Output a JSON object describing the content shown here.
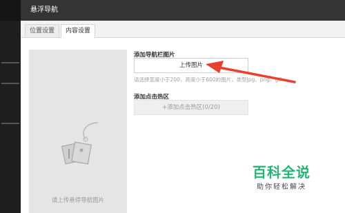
{
  "dialog": {
    "title": "悬浮导航"
  },
  "tabs": [
    {
      "label": "位置设置"
    },
    {
      "label": "内容设置"
    }
  ],
  "preview": {
    "placeholder": "请上传悬停导航图片"
  },
  "nav_image": {
    "label": "添加导航栏图片",
    "upload_button": "上传图片",
    "hint": "请选择宽度小于200，高度小于600的图片，类型jpg、png、gif"
  },
  "hotspot": {
    "label": "添加点击热区",
    "button": "+添加点击热区(0/20)"
  },
  "watermark": {
    "title": "百科全说",
    "subtitle": "助你轻松解决"
  },
  "colors": {
    "arrow": "#e8402f",
    "watermark": "#22b574",
    "titlebar": "#343434"
  }
}
